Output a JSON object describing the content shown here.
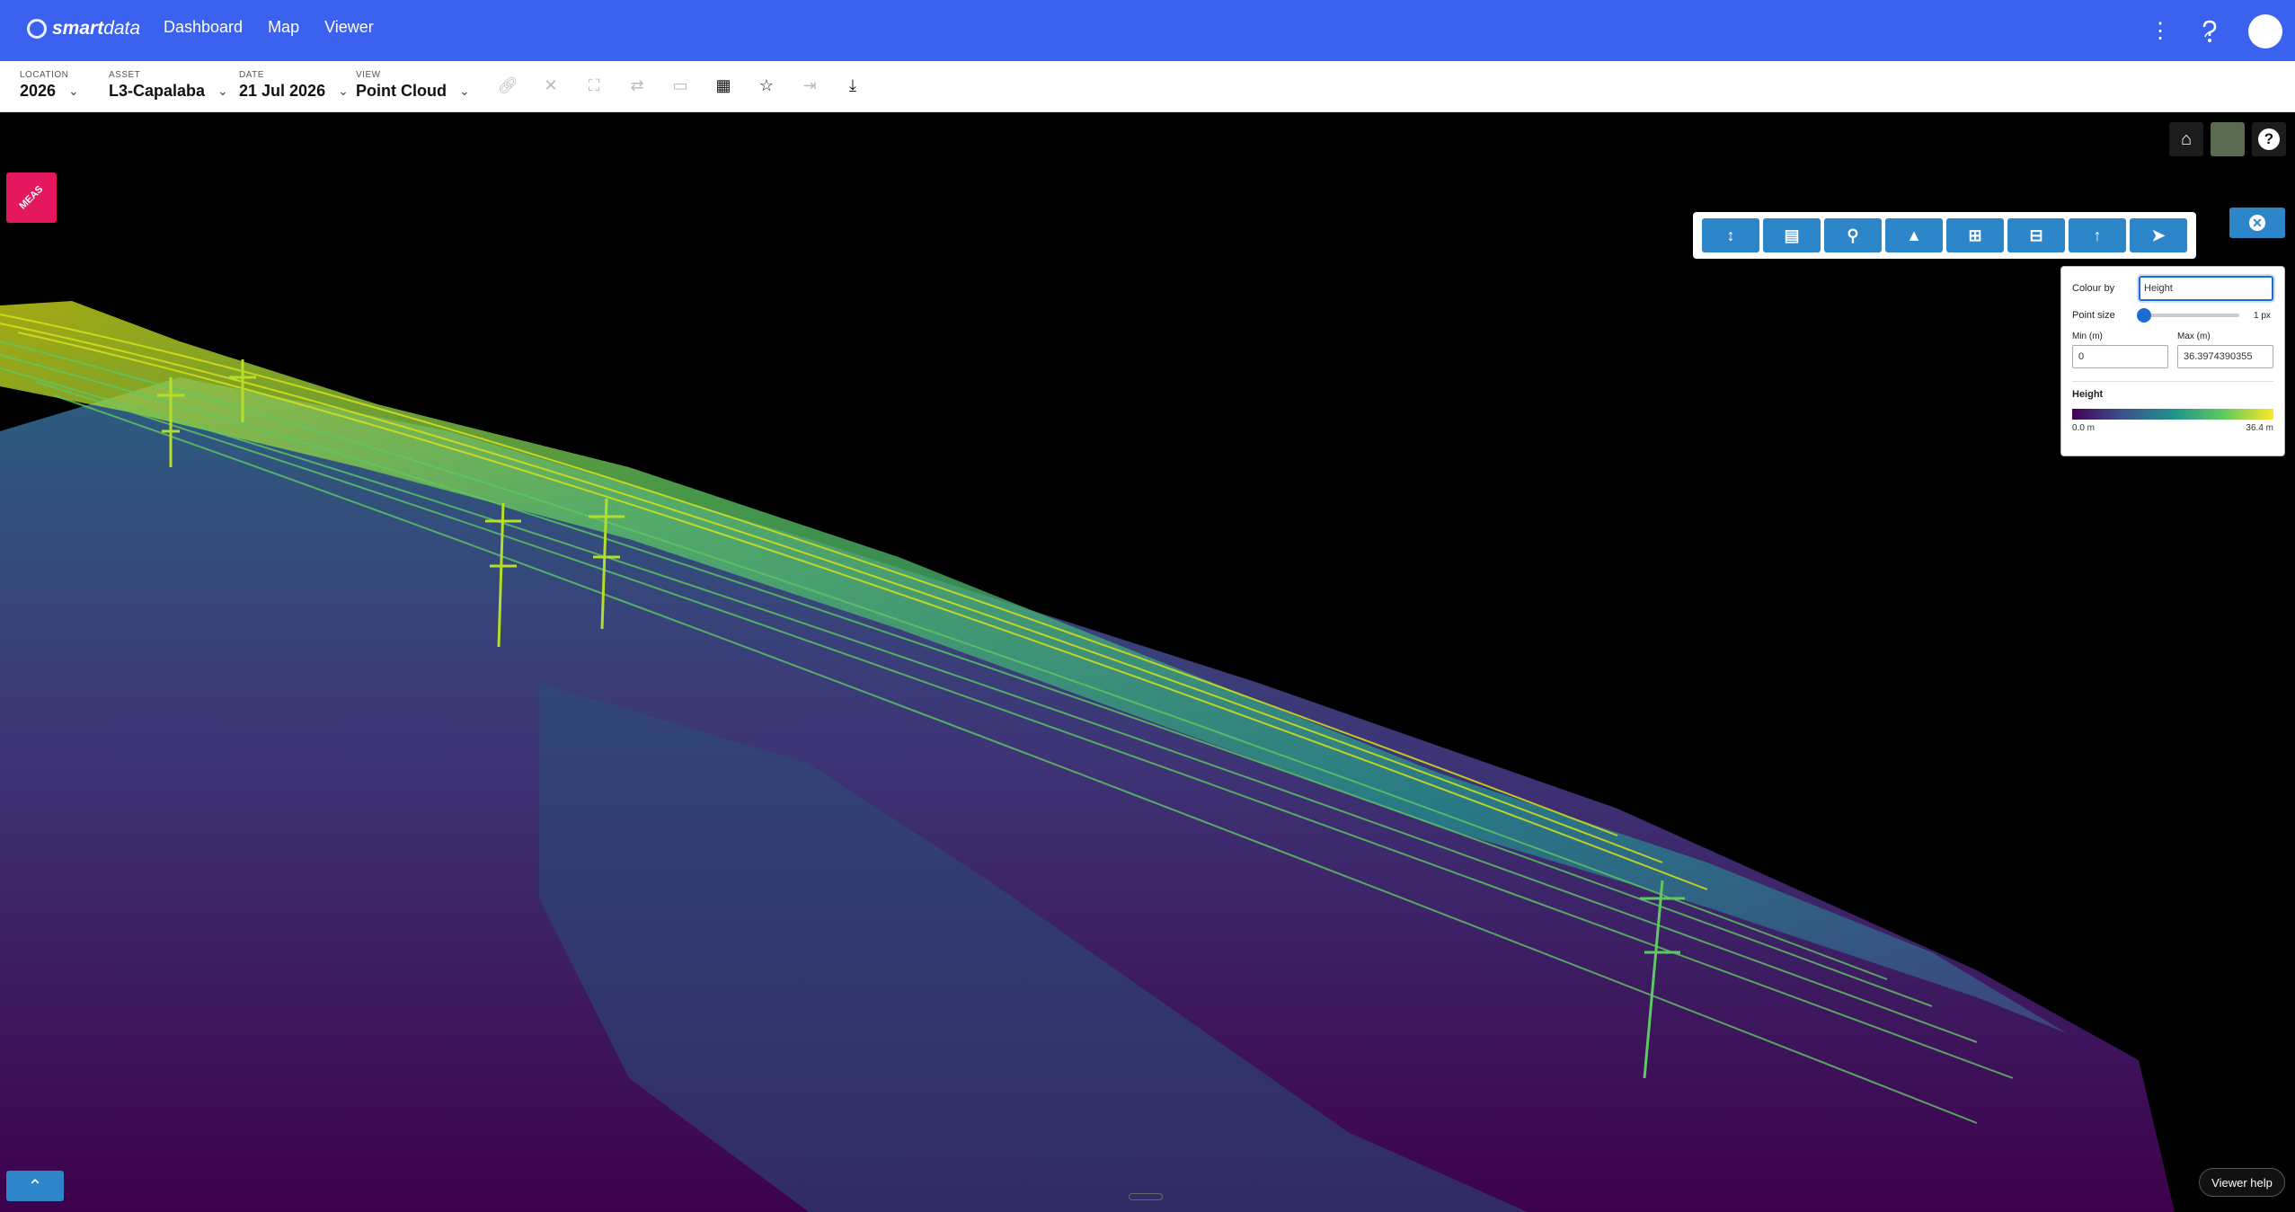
{
  "app": {
    "logo_bold": "smart",
    "logo_light": "data"
  },
  "nav": {
    "dashboard": "Dashboard",
    "map": "Map",
    "viewer": "Viewer"
  },
  "selectors": {
    "location": {
      "label": "LOCATION",
      "value": "2026"
    },
    "asset": {
      "label": "ASSET",
      "value": "L3-Capalaba"
    },
    "date": {
      "label": "DATE",
      "value": "21 Jul 2026"
    },
    "view": {
      "label": "VIEW",
      "value": "Point Cloud"
    }
  },
  "toolbar_icons": [
    "link-icon",
    "close-icon",
    "fullscreen-icon",
    "swap-icon",
    "document-icon",
    "grid-icon",
    "star-icon",
    "export-icon",
    "download-icon"
  ],
  "measure_tool": {
    "label": "MEAS"
  },
  "viewer_toolbar": [
    "height-measure",
    "clipboard",
    "person",
    "tree",
    "add-box",
    "remove-box",
    "up-arrow",
    "send"
  ],
  "panel": {
    "colour_by_label": "Colour by",
    "colour_by_value": "Height",
    "point_size_label": "Point size",
    "point_size_value": "1 px",
    "min_label": "Min (m)",
    "min_value": "0",
    "max_label": "Max (m)",
    "max_value": "36.3974390355",
    "legend_title": "Height",
    "legend_min": "0.0 m",
    "legend_max": "36.4 m"
  },
  "viewer_help": "Viewer help",
  "colors": {
    "topbar": "#3b62ee",
    "accent": "#2d86c9",
    "measure": "#e5175e"
  }
}
